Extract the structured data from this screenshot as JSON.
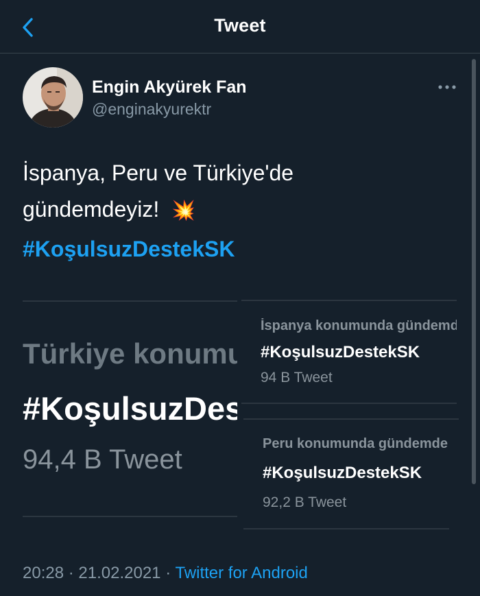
{
  "header": {
    "title": "Tweet",
    "back_icon": "chevron-left-icon"
  },
  "author": {
    "name": "Engin Akyürek Fan",
    "handle": "@enginakyurektr"
  },
  "tweet": {
    "line1": "İspanya, Peru ve Türkiye'de",
    "line2": "gündemdeyiz!",
    "emoji": "💥",
    "hashtag": "#KoşulsuzDestekSK"
  },
  "media": {
    "turkey": {
      "label": "Türkiye konumunda gündemde",
      "hashtag": "#KoşulsuzDestekSK",
      "count": "94,4 B Tweet"
    },
    "spain": {
      "label": "İspanya konumunda gündemde",
      "hashtag": "#KoşulsuzDestekSK",
      "count": "94 B Tweet"
    },
    "peru": {
      "label": "Peru konumunda gündemde",
      "hashtag": "#KoşulsuzDestekSK",
      "count": "92,2 B Tweet"
    }
  },
  "footer": {
    "time": "20:28",
    "separator": "·",
    "date": "21.02.2021",
    "source": "Twitter for Android"
  },
  "colors": {
    "background": "#15202b",
    "accent": "#1da1f2",
    "secondary_text": "#8899a6"
  }
}
